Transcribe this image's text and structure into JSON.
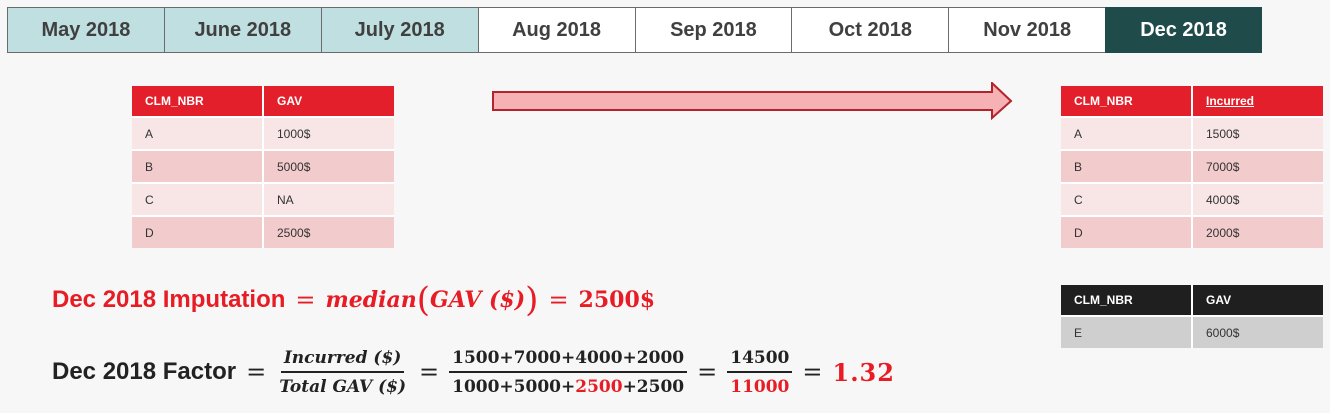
{
  "timeline": [
    {
      "label": "May 2018",
      "state": "past"
    },
    {
      "label": "June 2018",
      "state": "past"
    },
    {
      "label": "July 2018",
      "state": "past"
    },
    {
      "label": "Aug 2018",
      "state": "future"
    },
    {
      "label": "Sep 2018",
      "state": "future"
    },
    {
      "label": "Oct 2018",
      "state": "future"
    },
    {
      "label": "Nov 2018",
      "state": "future"
    },
    {
      "label": "Dec 2018",
      "state": "current"
    }
  ],
  "left_table": {
    "headers": [
      "CLM_NBR",
      "GAV"
    ],
    "rows": [
      [
        "A",
        "1000$"
      ],
      [
        "B",
        "5000$"
      ],
      [
        "C",
        "NA"
      ],
      [
        "D",
        "2500$"
      ]
    ]
  },
  "right_table": {
    "headers": [
      "CLM_NBR",
      "Incurred"
    ],
    "rows": [
      [
        "A",
        "1500$"
      ],
      [
        "B",
        "7000$"
      ],
      [
        "C",
        "4000$"
      ],
      [
        "D",
        "2000$"
      ]
    ]
  },
  "new_table": {
    "headers": [
      "CLM_NBR",
      "GAV"
    ],
    "rows": [
      [
        "E",
        "6000$"
      ]
    ]
  },
  "imputation": {
    "label": "Dec 2018 Imputation",
    "eq": "=",
    "func": "median",
    "arg": "GAV ($)",
    "result": "2500$"
  },
  "factor": {
    "label": "Dec 2018 Factor",
    "num1": "Incurred ($)",
    "den1": "Total GAV ($)",
    "num2": "1500+7000+4000+2000",
    "den2_a": "1000+5000+",
    "den2_b": "2500",
    "den2_c": "+2500",
    "num3": "14500",
    "den3": "11000",
    "result": "1.32"
  },
  "colors": {
    "accent": "#e21f2a",
    "current_month": "#1f4b4b",
    "past_month": "#bfdfe0"
  }
}
